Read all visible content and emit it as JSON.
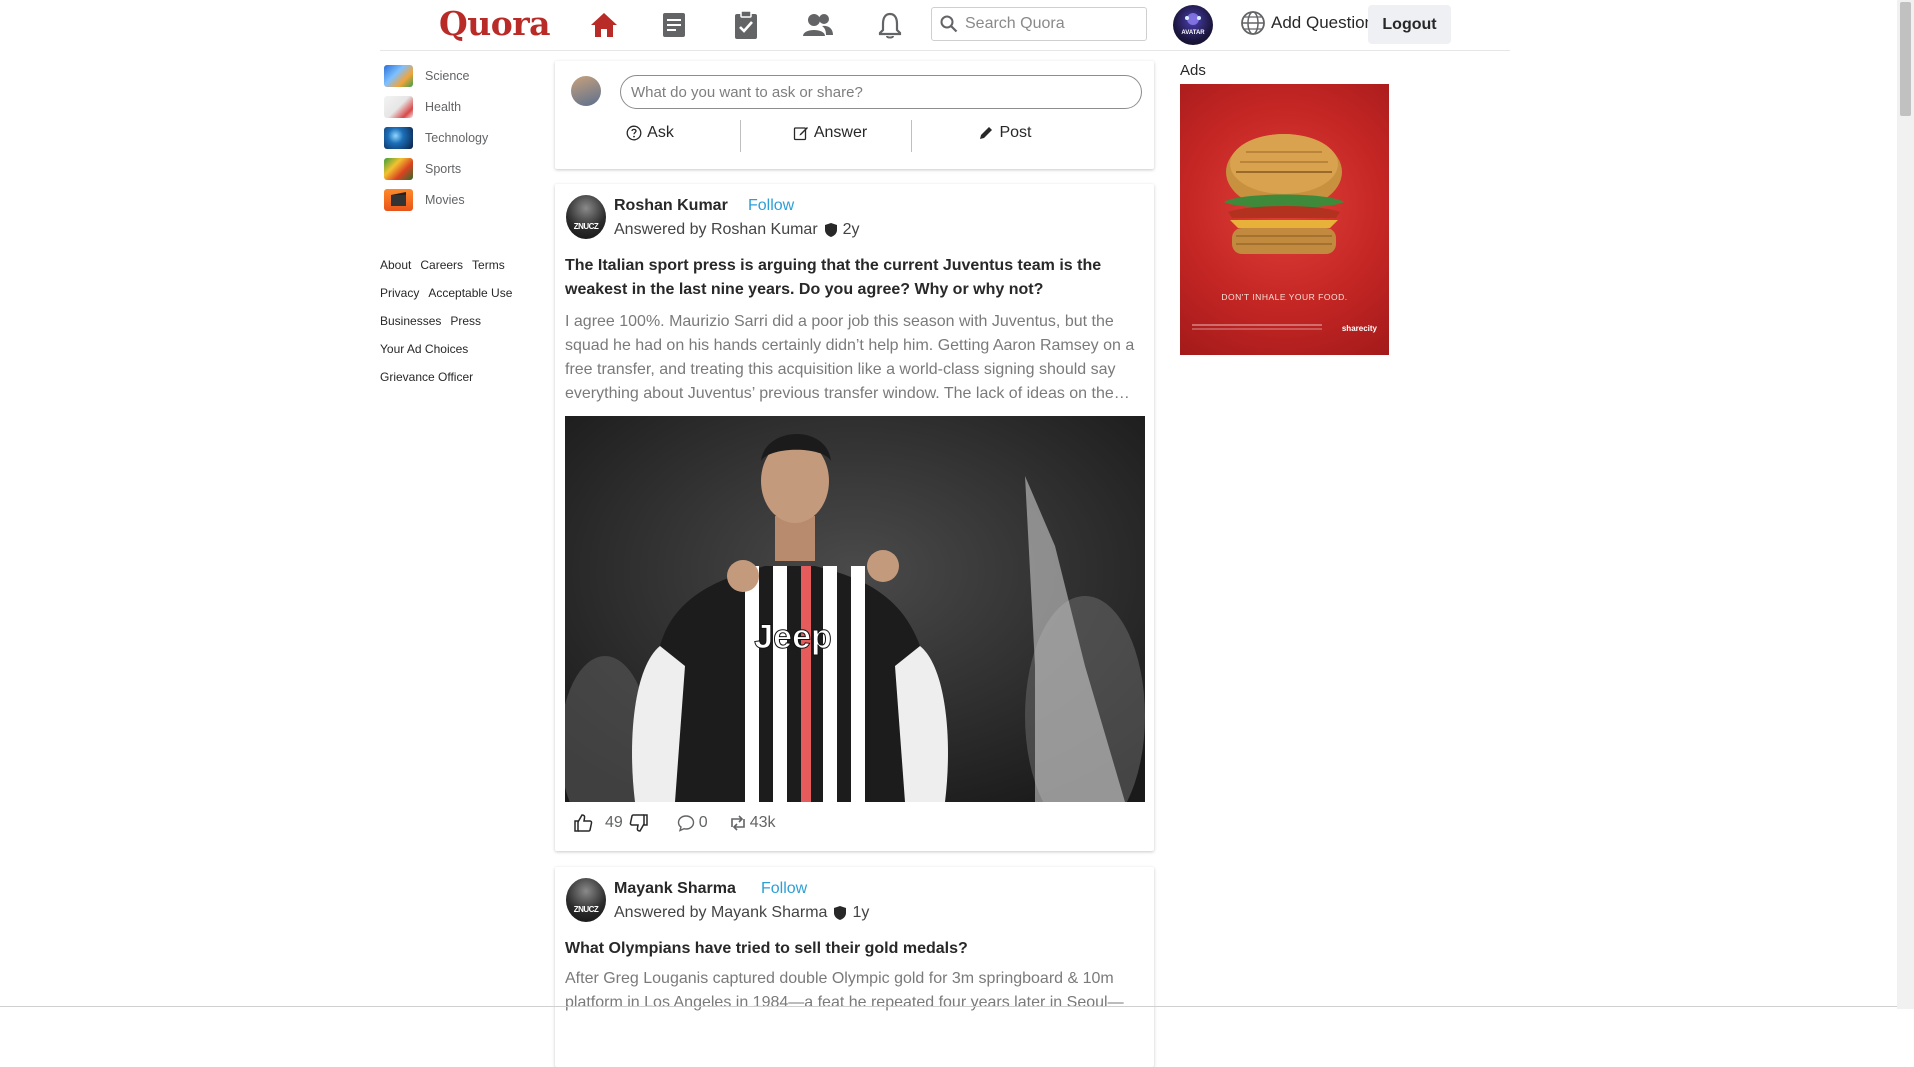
{
  "header": {
    "logo": "Quora",
    "search_placeholder": "Search Quora",
    "avatar_text": "AVATAR",
    "add_question": "Add Question",
    "logout": "Logout",
    "brand_color": "#b92b27",
    "nav_icons": [
      "home-icon",
      "answers-icon",
      "spaces-icon",
      "people-icon",
      "bell-icon"
    ]
  },
  "sidebar": {
    "items": [
      {
        "label": "Science"
      },
      {
        "label": "Health"
      },
      {
        "label": "Technology"
      },
      {
        "label": "Sports"
      },
      {
        "label": "Movies"
      }
    ],
    "footer": {
      "about": "About",
      "careers": "Careers",
      "terms": "Terms",
      "privacy": "Privacy",
      "acceptable_use": "Acceptable Use",
      "businesses": "Businesses",
      "press": "Press",
      "ad_choices": "Your Ad Choices",
      "grievance": "Grievance Officer"
    }
  },
  "composer": {
    "placeholder": "What do you want to ask or share?",
    "ask": "Ask",
    "answer": "Answer",
    "post": "Post"
  },
  "posts": [
    {
      "author": "Roshan Kumar",
      "follow": "Follow",
      "answered_by": "Answered by Roshan Kumar",
      "age": "2y",
      "question": "The Italian sport press is arguing that the current Juventus team is the weakest in the last nine years. Do you agree? Why or why not?",
      "answer": "I agree 100%. Maurizio Sarri did a poor job this season with Juventus, but the squad he had on his hands certainly didn’t help him. Getting Aaron Ramsey on a free transfer, and treating this acquisition like a world-class signing should say everything about Juventus’ previous transfer window. The lack of ideas on the…",
      "jersey_text": "Jeep",
      "upvotes": "49",
      "comments": "0",
      "shares": "43k"
    },
    {
      "author": "Mayank Sharma",
      "follow": "Follow",
      "answered_by": "Answered by Mayank Sharma",
      "age": "1y",
      "question": "What Olympians have tried to sell their gold medals?",
      "answer": "After Greg Louganis captured double Olympic gold for 3m springboard & 10m platform in Los Angeles in 1984—a feat he repeated four years later in Seoul—"
    }
  ],
  "ads": {
    "label": "Ads",
    "caption": "DON'T INHALE YOUR FOOD.",
    "brand": "sharecity"
  }
}
